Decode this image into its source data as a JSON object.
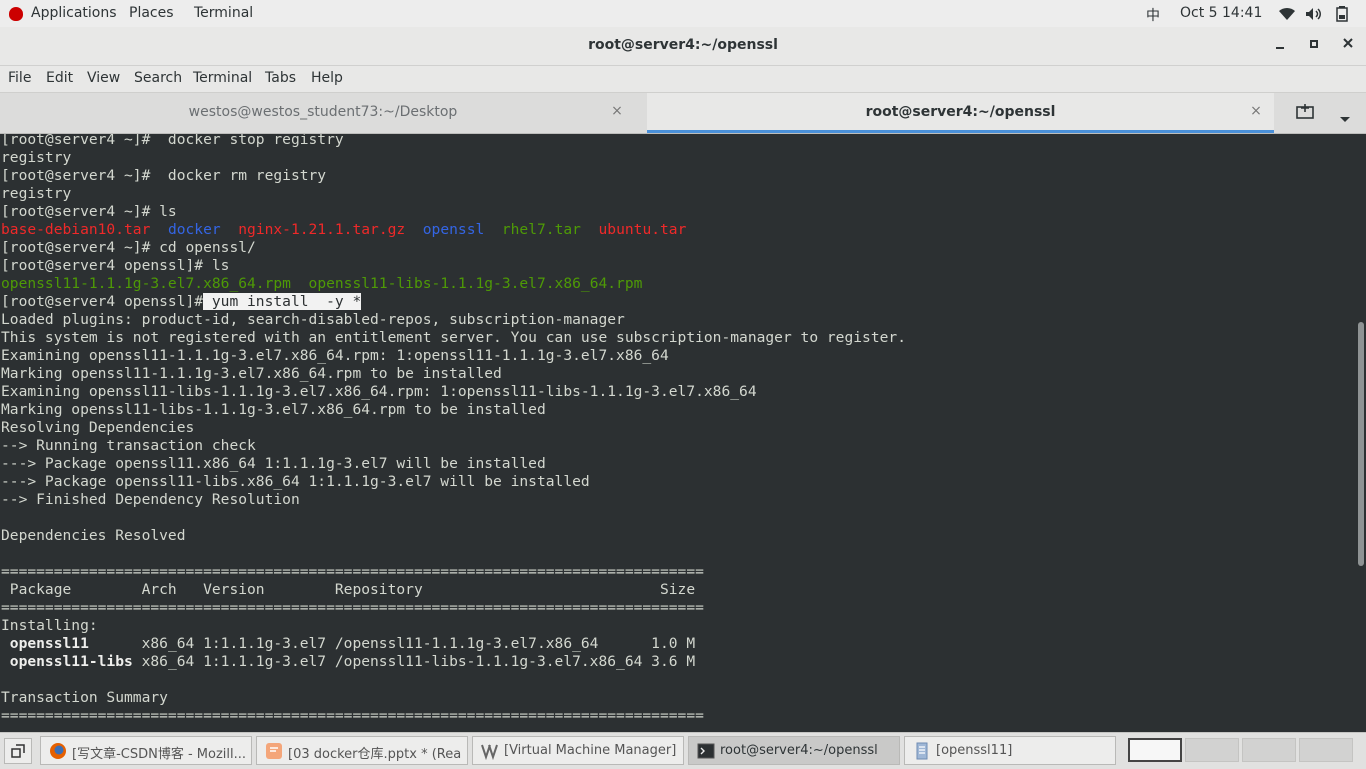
{
  "topbar": {
    "applications": "Applications",
    "places": "Places",
    "terminal": "Terminal",
    "input_method": "中",
    "datetime": "Oct 5  14:41"
  },
  "window": {
    "title": "root@server4:~/openssl"
  },
  "menubar": [
    "File",
    "Edit",
    "View",
    "Search",
    "Terminal",
    "Tabs",
    "Help"
  ],
  "tabs": [
    {
      "label": "westos@westos_student73:~/Desktop"
    },
    {
      "label": "root@server4:~/openssl"
    }
  ],
  "terminal": {
    "l01": "[root@server4 ~]#  docker stop registry",
    "l02": "registry",
    "l03": "[root@server4 ~]#  docker rm registry",
    "l04": "registry",
    "l05": "[root@server4 ~]# ls",
    "l06": {
      "f1": "base-debian10.tar",
      "f2": "docker",
      "f3": "nginx-1.21.1.tar.gz",
      "f4": "openssl",
      "f5": "rhel7.tar",
      "f6": "ubuntu.tar"
    },
    "l07": "[root@server4 ~]# cd openssl/",
    "l08": "[root@server4 openssl]# ls",
    "l09": {
      "f1": "openssl11-1.1.1g-3.el7.x86_64.rpm",
      "f2": "openssl11-libs-1.1.1g-3.el7.x86_64.rpm"
    },
    "l10": {
      "prompt": "[root@server4 openssl]#",
      "cmd": " yum install  -y *"
    },
    "l11": "Loaded plugins: product-id, search-disabled-repos, subscription-manager",
    "l12": "This system is not registered with an entitlement server. You can use subscription-manager to register.",
    "l13": "Examining openssl11-1.1.1g-3.el7.x86_64.rpm: 1:openssl11-1.1.1g-3.el7.x86_64",
    "l14": "Marking openssl11-1.1.1g-3.el7.x86_64.rpm to be installed",
    "l15": "Examining openssl11-libs-1.1.1g-3.el7.x86_64.rpm: 1:openssl11-libs-1.1.1g-3.el7.x86_64",
    "l16": "Marking openssl11-libs-1.1.1g-3.el7.x86_64.rpm to be installed",
    "l17": "Resolving Dependencies",
    "l18": "--> Running transaction check",
    "l19": "---> Package openssl11.x86_64 1:1.1.1g-3.el7 will be installed",
    "l20": "---> Package openssl11-libs.x86_64 1:1.1.1g-3.el7 will be installed",
    "l21": "--> Finished Dependency Resolution",
    "l23": "Dependencies Resolved",
    "l25": "================================================================================",
    "l26": " Package        Arch   Version        Repository                           Size",
    "l27": "================================================================================",
    "l28": "Installing:",
    "l29": {
      "pkg": " openssl11     ",
      "rest": " x86_64 1:1.1.1g-3.el7 /openssl11-1.1.1g-3.el7.x86_64      1.0 M"
    },
    "l30": {
      "pkg": " openssl11-libs",
      "rest": " x86_64 1:1.1.1g-3.el7 /openssl11-libs-1.1.1g-3.el7.x86_64 3.6 M"
    },
    "l32": "Transaction Summary",
    "l33": "================================================================================"
  },
  "taskbar": [
    {
      "label": "[写文章-CSDN博客 - Mozill..."
    },
    {
      "label": "[03 docker仓库.pptx * (Rea..."
    },
    {
      "label": "[Virtual Machine Manager]"
    },
    {
      "label": "root@server4:~/openssl"
    },
    {
      "label": "[openssl11]"
    }
  ]
}
